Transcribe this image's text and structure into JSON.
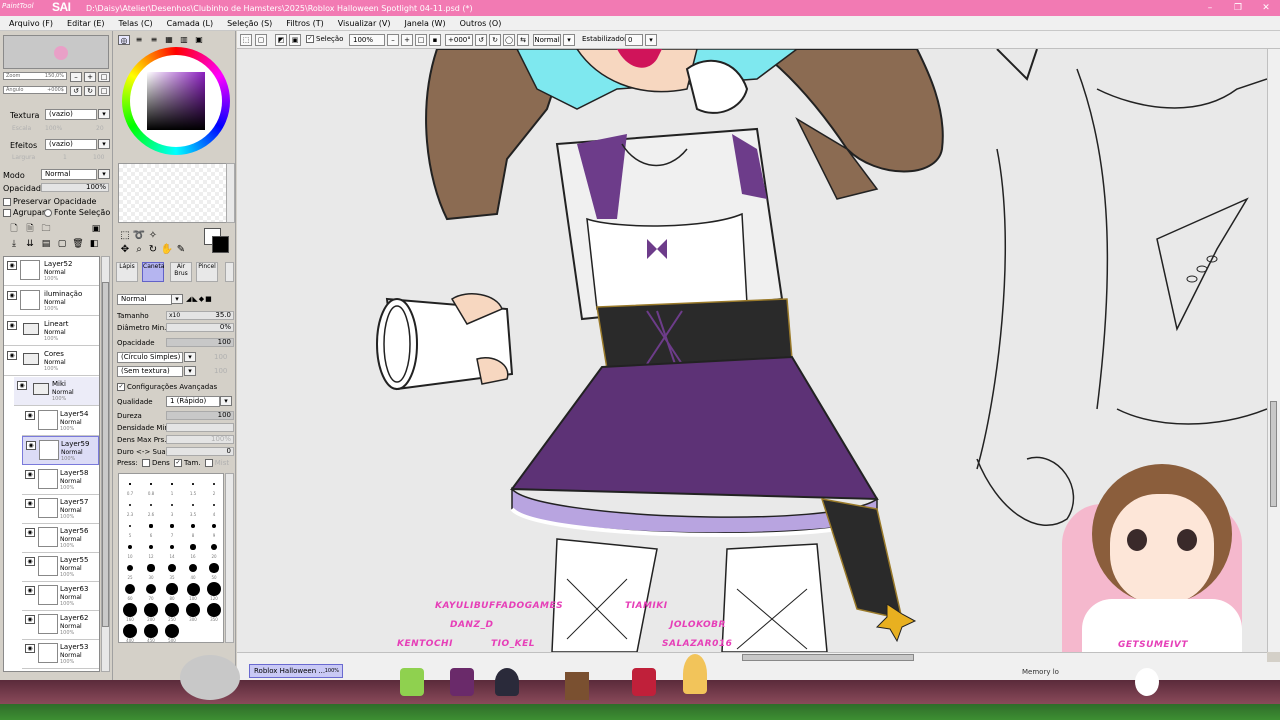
{
  "window": {
    "logo_small": "PaintTool",
    "logo_big": "SAI",
    "title": "D:\\Daisy\\Atelier\\Desenhos\\Clubinho de Hamsters\\2025\\Roblox Halloween Spotlight 04-11.psd (*)",
    "controls": [
      "–",
      "❐",
      "✕"
    ]
  },
  "menu": [
    "Arquivo (F)",
    "Editar (E)",
    "Telas (C)",
    "Camada (L)",
    "Seleção (S)",
    "Filtros (T)",
    "Visualizar (V)",
    "Janela (W)",
    "Outros (O)"
  ],
  "navigator": {
    "zoom_label": "Zoom",
    "zoom_value": "150,0%",
    "angle_label": "Ângulo",
    "angle_value": "+000$"
  },
  "layer_props": {
    "texture_label": "Textura",
    "texture_value": "(vazio)",
    "scale_label": "Escala",
    "scale_value": "100%",
    "scale_num": "20",
    "effects_label": "Efeitos",
    "effects_value": "(vazio)",
    "width_label": "Largura",
    "width_value": "1",
    "width_num": "100",
    "mode_label": "Modo",
    "mode_value": "Normal",
    "opacity_label": "Opacidade",
    "opacity_value": "100%",
    "preserve_label": "Preservar Opacidade",
    "clip_label": "Agrupar",
    "source_label": "Fonte Seleção"
  },
  "layers": [
    {
      "name": "Layer52",
      "mode": "Normal",
      "opacity": "100%",
      "type": "layer"
    },
    {
      "name": "iluminação",
      "mode": "Normal",
      "opacity": "100%",
      "type": "layer"
    },
    {
      "name": "Lineart",
      "mode": "Normal",
      "opacity": "100%",
      "type": "folder"
    },
    {
      "name": "Cores",
      "mode": "Normal",
      "opacity": "100%",
      "type": "folder"
    },
    {
      "name": "Miki",
      "mode": "Normal",
      "opacity": "100%",
      "type": "folder"
    },
    {
      "name": "Layer54",
      "mode": "Normal",
      "opacity": "100%",
      "type": "layer"
    },
    {
      "name": "Layer59",
      "mode": "Normal",
      "opacity": "100%",
      "type": "layer"
    },
    {
      "name": "Layer58",
      "mode": "Normal",
      "opacity": "100%",
      "type": "layer"
    },
    {
      "name": "Layer57",
      "mode": "Normal",
      "opacity": "100%",
      "type": "layer"
    },
    {
      "name": "Layer56",
      "mode": "Normal",
      "opacity": "100%",
      "type": "layer"
    },
    {
      "name": "Layer55",
      "mode": "Normal",
      "opacity": "100%",
      "type": "layer"
    },
    {
      "name": "Layer63",
      "mode": "Normal",
      "opacity": "100%",
      "type": "layer"
    },
    {
      "name": "Layer62",
      "mode": "Normal",
      "opacity": "100%",
      "type": "layer"
    },
    {
      "name": "Layer53",
      "mode": "Normal",
      "opacity": "100%",
      "type": "layer"
    }
  ],
  "color": {
    "primary": "#000000",
    "hue": "#8b1fc0"
  },
  "brush_tabs": [
    "Lápis",
    "Caneta",
    "Air Brus",
    "Pincel"
  ],
  "brush": {
    "mode": "Normal",
    "size_label": "Tamanho",
    "size_mult": "x10",
    "size_value": "35.0",
    "min_diam_label": "Diâmetro Min.",
    "min_diam_value": "0%",
    "opacity_label": "Opacidade",
    "opacity_value": "100",
    "shape": "(Círculo Simples)",
    "shape_num": "100",
    "texture": "(Sem textura)",
    "texture_num": "100",
    "advanced_label": "Configurações Avançadas",
    "quality_label": "Qualidade",
    "quality_value": "1 (Rápido)",
    "hardness_label": "Dureza",
    "hardness_value": "100",
    "min_density_label": "Densidade Min.",
    "max_dens_label": "Dens Max Prs.",
    "max_dens_value": "100%",
    "smooth_label": "Duro <-> Suave",
    "smooth_value": "0",
    "press_label": "Press:",
    "press_dens": "Dens",
    "press_size": "Tam.",
    "press_mix": "Mist"
  },
  "brush_sizes": [
    "0.7",
    "0.8",
    "1",
    "1.5",
    "2",
    "2.3",
    "2.6",
    "3",
    "3.5",
    "4",
    "5",
    "6",
    "7",
    "8",
    "9",
    "10",
    "12",
    "14",
    "16",
    "20",
    "25",
    "30",
    "35",
    "40",
    "50",
    "60",
    "70",
    "80",
    "100",
    "120",
    "160",
    "200",
    "250",
    "300",
    "350",
    "400",
    "450",
    "500"
  ],
  "canvas_toolbar": {
    "selection_label": "Seleção",
    "zoom": "100%",
    "angle": "+000°",
    "blend": "Normal",
    "stabilizer_label": "Estabilizador",
    "stabilizer_value": "0"
  },
  "doc_tab": {
    "name": "Roblox Halloween ...",
    "zoom": "100%"
  },
  "memory_label": "Memory lo",
  "credits": [
    "KAYULIBUFFADOGAMES",
    "TIAMIKI",
    "DANZ_D",
    "JOLOKOBR",
    "KENTOCHI",
    "TIO_KEL",
    "SALAZAR016",
    "GETSUMEIVT"
  ]
}
